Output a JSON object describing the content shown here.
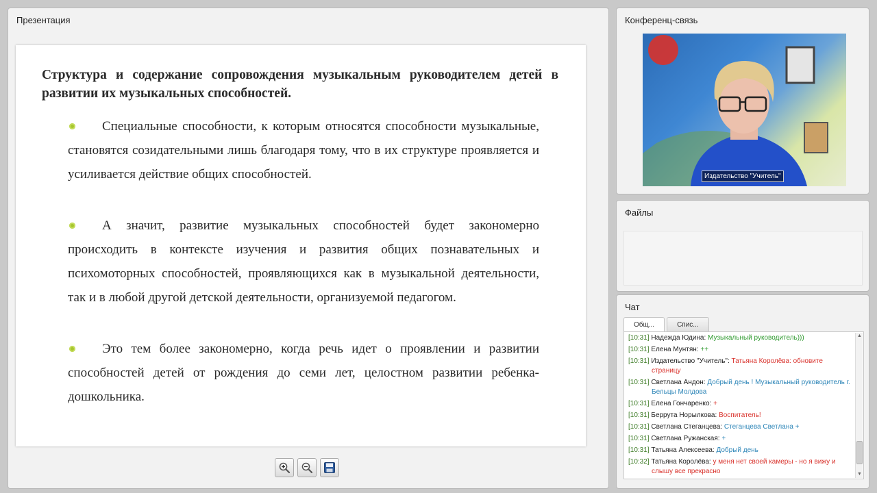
{
  "presentation": {
    "title": "Презентация",
    "slide": {
      "heading": "Структура и содержание сопровождения музыкальным руководителем детей в развитии их музыкальных способностей.",
      "bullets": [
        "Специальные способности, к которым относятся способности музыкальные, становятся созидательными лишь благодаря тому, что в их структуре проявляется и усиливается действие общих способностей.",
        "А значит, развитие музыкальных способностей будет закономерно происходить в контексте изучения и развития общих познавательных и психомоторных способностей, проявляющихся как в музыкальной деятельности, так и в любой другой детской деятельности, организуемой педагогом.",
        "Это тем более закономерно, когда речь идет о проявлении и развитии способностей детей от рождения до семи лет, целостном развитии ребенка-дошкольника."
      ],
      "bullet_color": "#a6c52e"
    },
    "toolbar": [
      "zoom-in-icon",
      "zoom-out-icon",
      "save-icon"
    ]
  },
  "conference": {
    "title": "Конференц-связь",
    "video_label": "Издательство \"Учитель\""
  },
  "files": {
    "title": "Файлы"
  },
  "chat": {
    "title": "Чат",
    "tabs": [
      "Общ...",
      "Спис..."
    ],
    "messages": [
      {
        "time": "[10:31]",
        "author": "Надежда Юдина:",
        "text": "Музыкальный руководитель)))",
        "color": "green"
      },
      {
        "time": "[10:31]",
        "author": "Елена Мунтян:",
        "text": "++",
        "color": "green"
      },
      {
        "time": "[10:31]",
        "author": "Издательство \"Учитель\":",
        "text": "Татьяна Королёва: обновите страницу",
        "color": "red"
      },
      {
        "time": "[10:31]",
        "author": "Светлана Андон:",
        "text": "Добрый день ! Музыкальный руководитель г. Бельцы Молдова",
        "color": "blue"
      },
      {
        "time": "[10:31]",
        "author": "Елена Гончаренко:",
        "text": "+",
        "color": "red"
      },
      {
        "time": "[10:31]",
        "author": "Беррута Норылкова:",
        "text": "Воспитатель!",
        "color": "red"
      },
      {
        "time": "[10:31]",
        "author": "Светлана Стеганцева:",
        "text": "Стеганцева Светлана +",
        "color": "blue"
      },
      {
        "time": "[10:31]",
        "author": "Светлана Ружанская:",
        "text": "+",
        "color": "blue"
      },
      {
        "time": "[10:31]",
        "author": "Татьяна Алексеева:",
        "text": "Добрый день",
        "color": "blue"
      },
      {
        "time": "[10:32]",
        "author": "Татьяна Королёва:",
        "text": "у меня нет своей камеры - но я вижу и слышу все прекрасно",
        "color": "red"
      }
    ]
  }
}
